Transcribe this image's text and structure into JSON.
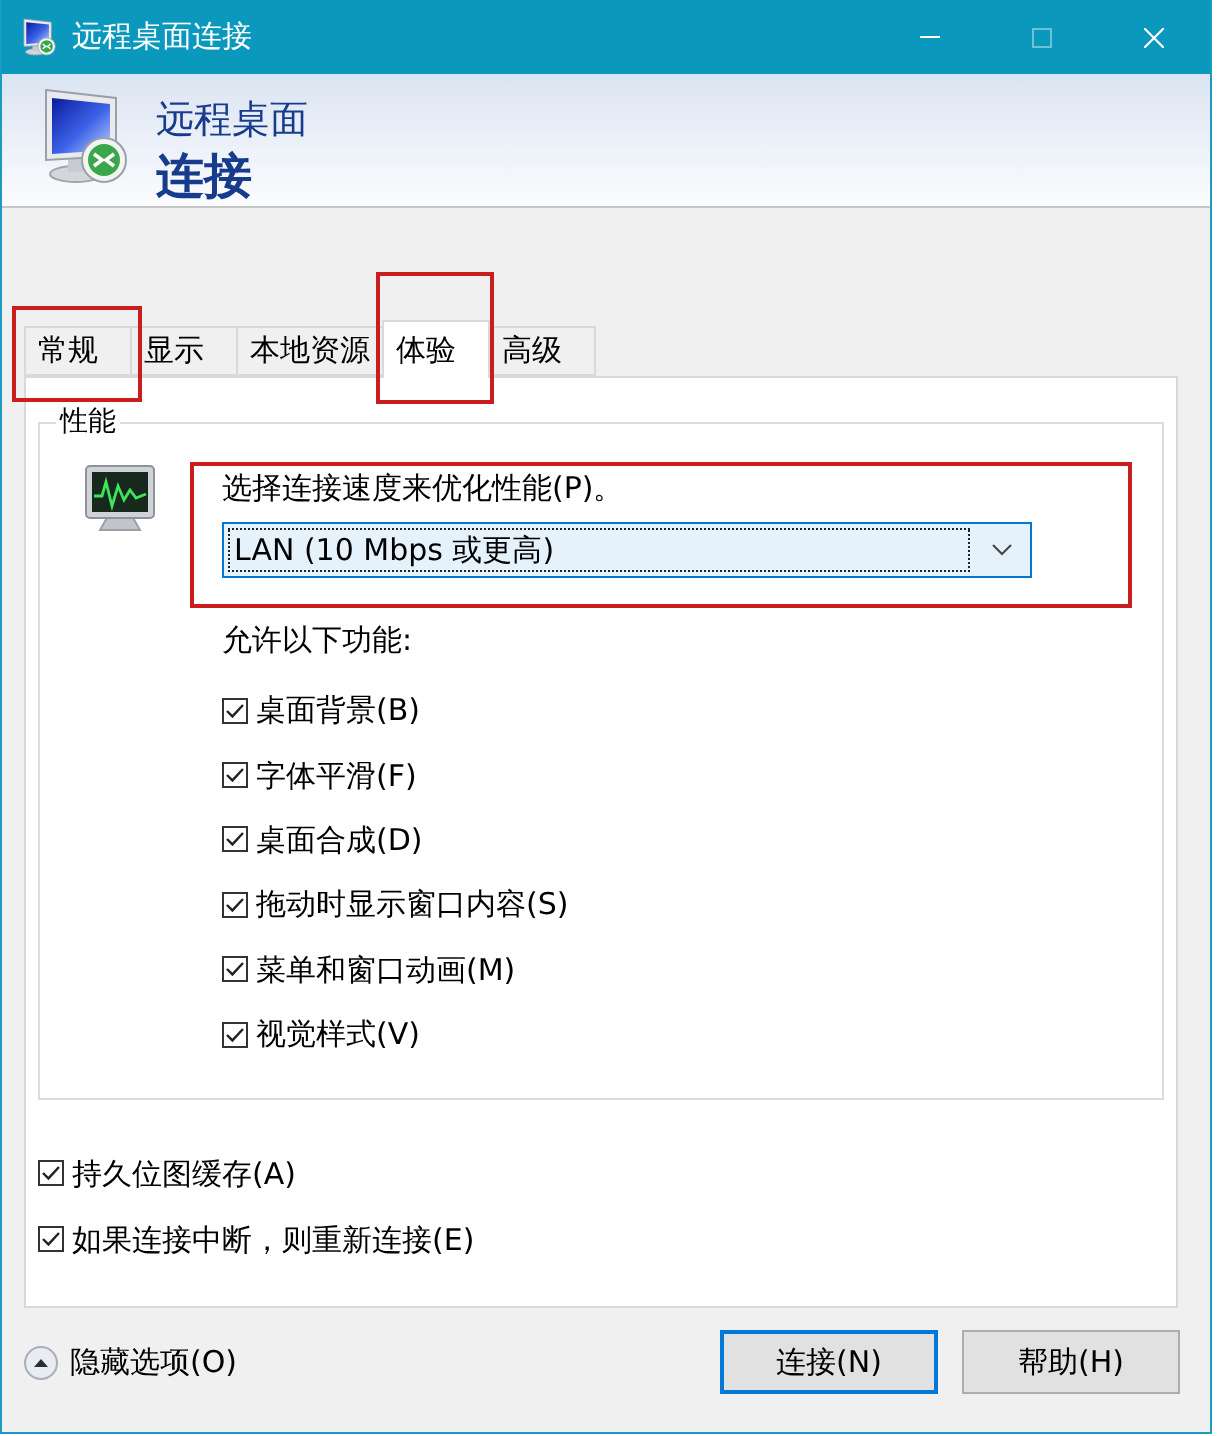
{
  "window": {
    "title": "远程桌面连接",
    "controls": [
      {
        "kind": "minimize",
        "disabled": false
      },
      {
        "kind": "maximize",
        "disabled": true
      },
      {
        "kind": "close",
        "disabled": false
      }
    ]
  },
  "header": {
    "title": "远程桌面",
    "subtitle": "连接"
  },
  "tabs": [
    {
      "label": "常规",
      "selected": false,
      "highlighted": true
    },
    {
      "label": "显示",
      "selected": false,
      "highlighted": false
    },
    {
      "label": "本地资源",
      "selected": false,
      "highlighted": false
    },
    {
      "label": "体验",
      "selected": true,
      "highlighted": true
    },
    {
      "label": "高级",
      "selected": false,
      "highlighted": false
    }
  ],
  "performance": {
    "title": "性能",
    "speed_label": "选择连接速度来优化性能(P)。",
    "speed_select": {
      "value": "LAN (10 Mbps 或更高)",
      "highlighted": true
    },
    "features_label": "允许以下功能:",
    "features": [
      {
        "label": "桌面背景(B)",
        "checked": true
      },
      {
        "label": "字体平滑(F)",
        "checked": true
      },
      {
        "label": "桌面合成(D)",
        "checked": true
      },
      {
        "label": "拖动时显示窗口内容(S)",
        "checked": true
      },
      {
        "label": "菜单和窗口动画(M)",
        "checked": true
      },
      {
        "label": "视觉样式(V)",
        "checked": true
      }
    ]
  },
  "options": [
    {
      "label": "持久位图缓存(A)",
      "checked": true
    },
    {
      "label": "如果连接中断，则重新连接(E)",
      "checked": true
    }
  ],
  "hide_options": {
    "label": "隐藏选项(O)"
  },
  "buttons": [
    {
      "label": "连接(N)",
      "default": true
    },
    {
      "label": "帮助(H)",
      "default": false
    }
  ]
}
